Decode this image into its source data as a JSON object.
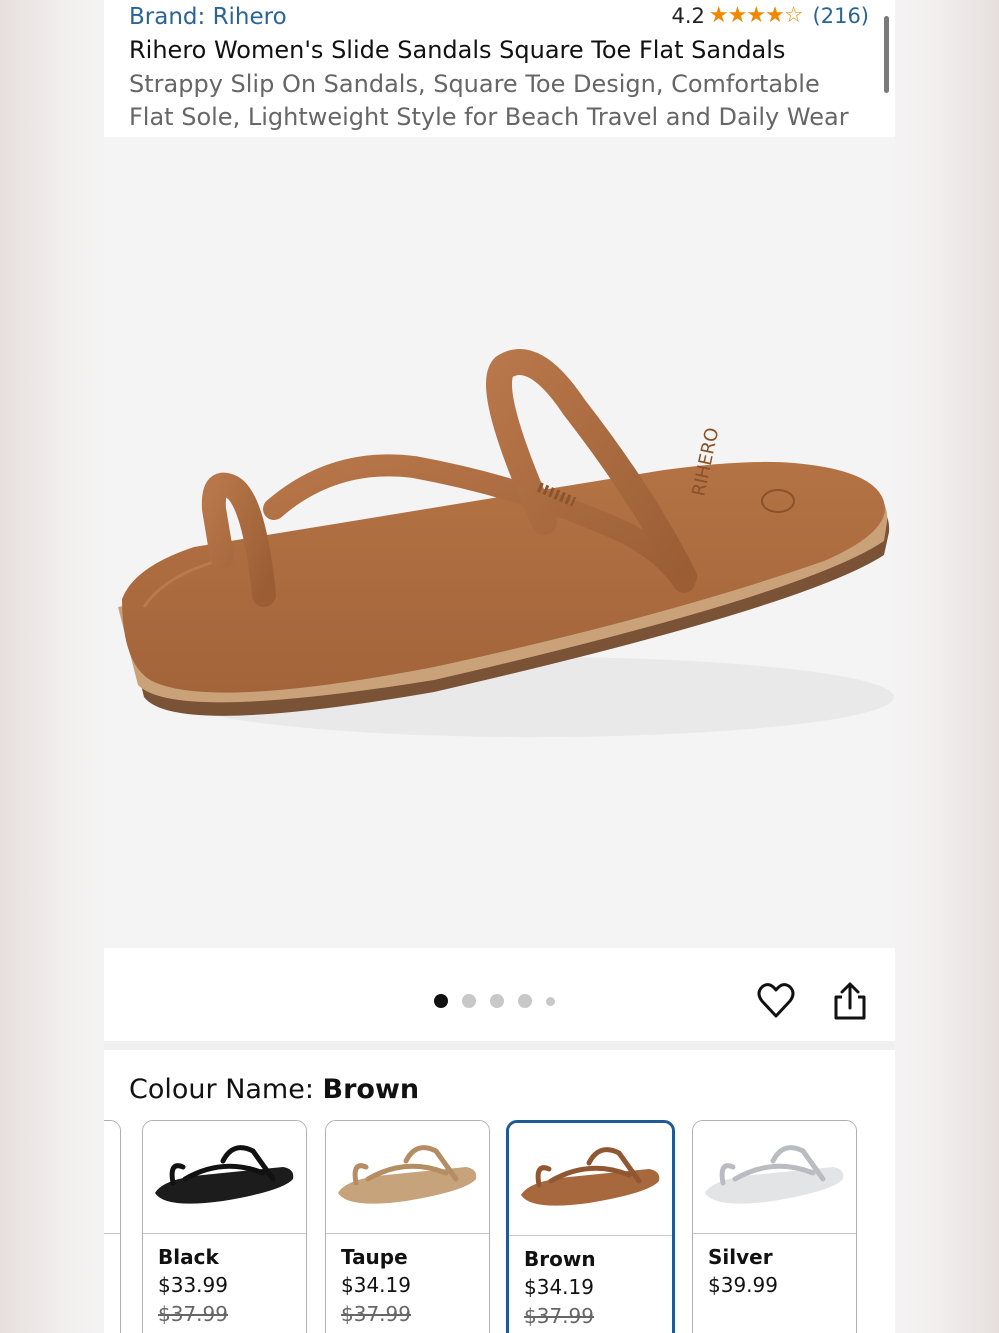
{
  "header": {
    "brand": "Brand: Rihero",
    "rating_value": "4.2",
    "rating_stars": "★★★★☆",
    "rating_count": "(216)",
    "title": "Rihero Women's Slide Sandals Square Toe Flat Sandals",
    "subtitle": "Strappy Slip On Sandals, Square Toe Design, Comfortable Flat Sole, Lightweight Style for Beach Travel and Daily Wear"
  },
  "gallery": {
    "image_count": 5,
    "active_index": 0
  },
  "colour": {
    "label": "Colour Name: ",
    "selected": "Brown",
    "options": [
      {
        "name": "Black",
        "price": "$33.99",
        "old_price": "$37.99"
      },
      {
        "name": "Taupe",
        "price": "$34.19",
        "old_price": "$37.99"
      },
      {
        "name": "Brown",
        "price": "$34.19",
        "old_price": "$37.99"
      },
      {
        "name": "Silver",
        "price": "$39.99",
        "old_price": ""
      }
    ]
  },
  "colors": {
    "link": "#2a6496",
    "star": "#f08804",
    "selected_border": "#1f5a96",
    "deal_bar": "#c7235f"
  }
}
